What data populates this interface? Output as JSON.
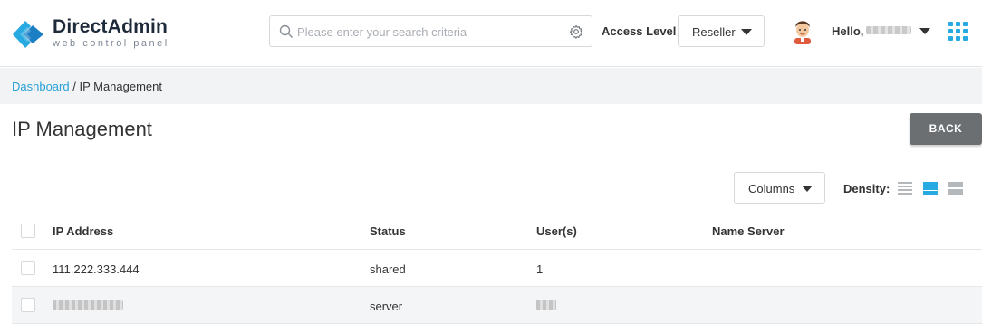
{
  "brand": {
    "title": "DirectAdmin",
    "subtitle": "web control panel",
    "accent": "#27a9e1"
  },
  "header": {
    "search_placeholder": "Please enter your search criteria",
    "access_level_label": "Access Level",
    "access_level_value": "Reseller",
    "hello_label": "Hello,"
  },
  "breadcrumb": {
    "root": "Dashboard",
    "separator": " / ",
    "current": "IP Management"
  },
  "page": {
    "title": "IP Management",
    "back_label": "BACK"
  },
  "toolbar": {
    "columns_label": "Columns",
    "density_label": "Density:",
    "density_selected": "medium"
  },
  "table": {
    "columns": [
      "IP Address",
      "Status",
      "User(s)",
      "Name Server"
    ],
    "rows": [
      {
        "ip": "111.222.333.444",
        "status": "shared",
        "users": "1",
        "name_server": ""
      },
      {
        "ip": "",
        "status": "server",
        "users": "",
        "name_server": ""
      }
    ]
  }
}
